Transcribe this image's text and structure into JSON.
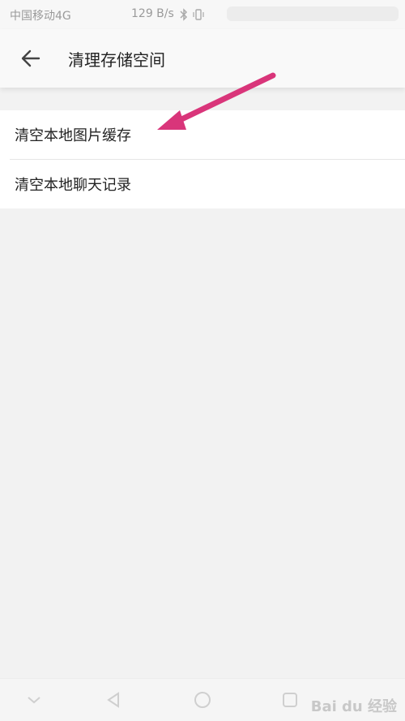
{
  "status_bar": {
    "carrier": "中国移动4G",
    "speed": "129 B/s",
    "icons": [
      "bluetooth-icon",
      "vibrate-icon"
    ]
  },
  "header": {
    "back_icon": "arrow-left-icon",
    "title": "清理存储空间"
  },
  "options": [
    {
      "label": "清空本地图片缓存"
    },
    {
      "label": "清空本地聊天记录"
    }
  ],
  "annotation": {
    "arrow_color": "#d9357a"
  },
  "nav_bar": {
    "icons": [
      "hide-keyboard-icon",
      "back-triangle-icon",
      "home-circle-icon",
      "recents-square-icon"
    ]
  },
  "watermark": {
    "text": "Bai du 经验"
  }
}
